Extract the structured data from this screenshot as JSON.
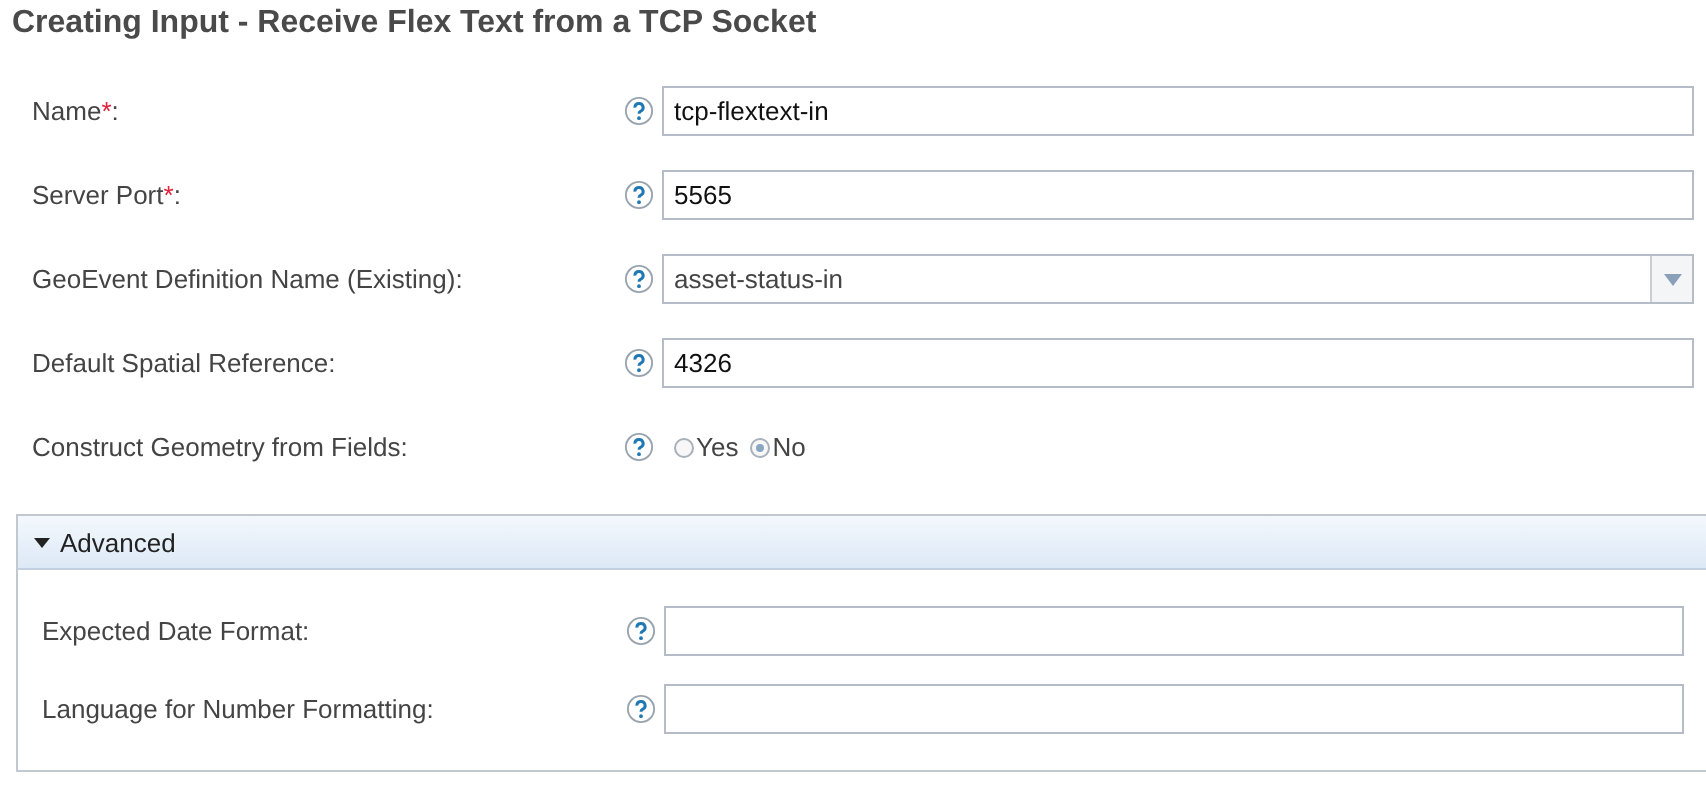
{
  "title": "Creating Input - Receive Flex Text from a TCP Socket",
  "fields": [
    {
      "kind": "text",
      "label": "Name",
      "required_mark": "*",
      "colon": ":",
      "value": "tcp-flextext-in"
    },
    {
      "kind": "text",
      "label": "Server Port",
      "required_mark": "*",
      "colon": ":",
      "value": "5565"
    },
    {
      "kind": "select",
      "label": "GeoEvent Definition Name (Existing):",
      "value": "asset-status-in"
    },
    {
      "kind": "text",
      "label": "Default Spatial Reference:",
      "value": "4326"
    },
    {
      "kind": "radio",
      "label": "Construct Geometry from Fields:",
      "options": [
        {
          "label": "Yes",
          "selected": false
        },
        {
          "label": "No",
          "selected": true
        }
      ]
    }
  ],
  "advanced": {
    "title": "Advanced",
    "expanded": true,
    "fields": [
      {
        "label": "Expected Date Format:"
      },
      {
        "label": "Language for Number Formatting:"
      }
    ]
  }
}
